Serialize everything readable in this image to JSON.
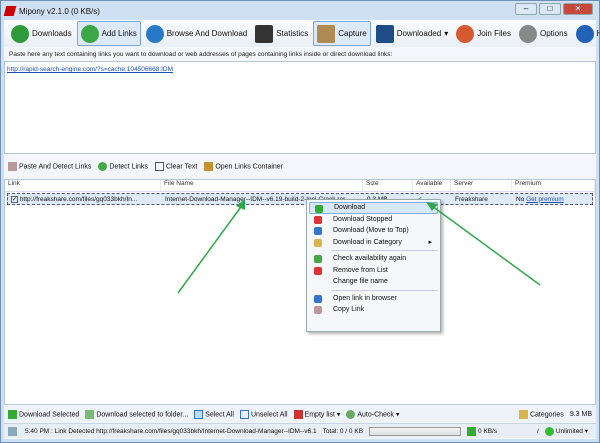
{
  "window": {
    "title": "Mipony v2.1.0 (0 KB/s)",
    "minimize": "–",
    "maximize": "□",
    "close": "✕"
  },
  "toolbar": [
    {
      "label": "Downloads",
      "icon": "downloads-globe-icon",
      "color": "#2e9a3a"
    },
    {
      "label": "Add Links",
      "icon": "add-links-icon",
      "color": "#3aa845"
    },
    {
      "label": "Browse And Download",
      "icon": "globe-icon",
      "color": "#2a79c9"
    },
    {
      "label": "Statistics",
      "icon": "statistics-icon",
      "color": "#333"
    },
    {
      "label": "Capture",
      "icon": "clipboard-icon",
      "color": "#b08a52"
    },
    {
      "label": "Downloaded",
      "icon": "downloaded-icon",
      "color": "#1e4c86"
    },
    {
      "label": "Join Files",
      "icon": "puzzle-icon",
      "color": "#d65a2f"
    },
    {
      "label": "Options",
      "icon": "tools-icon",
      "color": "#888"
    },
    {
      "label": "Help",
      "icon": "help-icon",
      "color": "#2263b8"
    }
  ],
  "hint": "Paste here any text containing links you want to download or web addresses of pages containing links inside or direct download links:",
  "textarea_link": "http://rapid-search-engine.com/?s=cache:104506668:IDM",
  "link_toolbar": [
    "Paste And Detect Links",
    "Detect Links",
    "Clear Text",
    "Open Links Container"
  ],
  "table": {
    "headers": [
      "Link",
      "File Name",
      "Size",
      "Available",
      "Server",
      "Premium"
    ],
    "rows": [
      {
        "link": "http://freakshare.com/files/gq033bkh/In...",
        "file_name": "Internet-Download-Manager--IDM--v6.19-build-2-Incl-Crack.rar",
        "size": "9.3 MB",
        "available": "✔",
        "server": "Freakshare",
        "premium": "No",
        "premium_link": "Get premium"
      }
    ]
  },
  "context_menu": [
    "Download",
    "Download Stopped",
    "Download (Move to Top)",
    "Download in Category",
    "Check availability again",
    "Remove from List",
    "Change file name",
    "Open link in browser",
    "Copy Link"
  ],
  "bottom_toolbar": {
    "download_selected": "Download Selected",
    "download_to_folder": "Download selected to folder...",
    "select_all": "Select All",
    "unselect_all": "Unselect All",
    "empty_list": "Empty list",
    "auto_check": "Auto-Check",
    "categories": "Categories",
    "size": "9.3 MB"
  },
  "status": {
    "message": "5:40 PM : Link Detected http://freakshare.com/files/gq033bkh/Internet-Download-Manager--IDM--v6.1",
    "total": "Total: 0 / 0 KB",
    "progress": 0,
    "speed": "0 KB/s",
    "slash": "/",
    "limit": "Unlimited"
  }
}
